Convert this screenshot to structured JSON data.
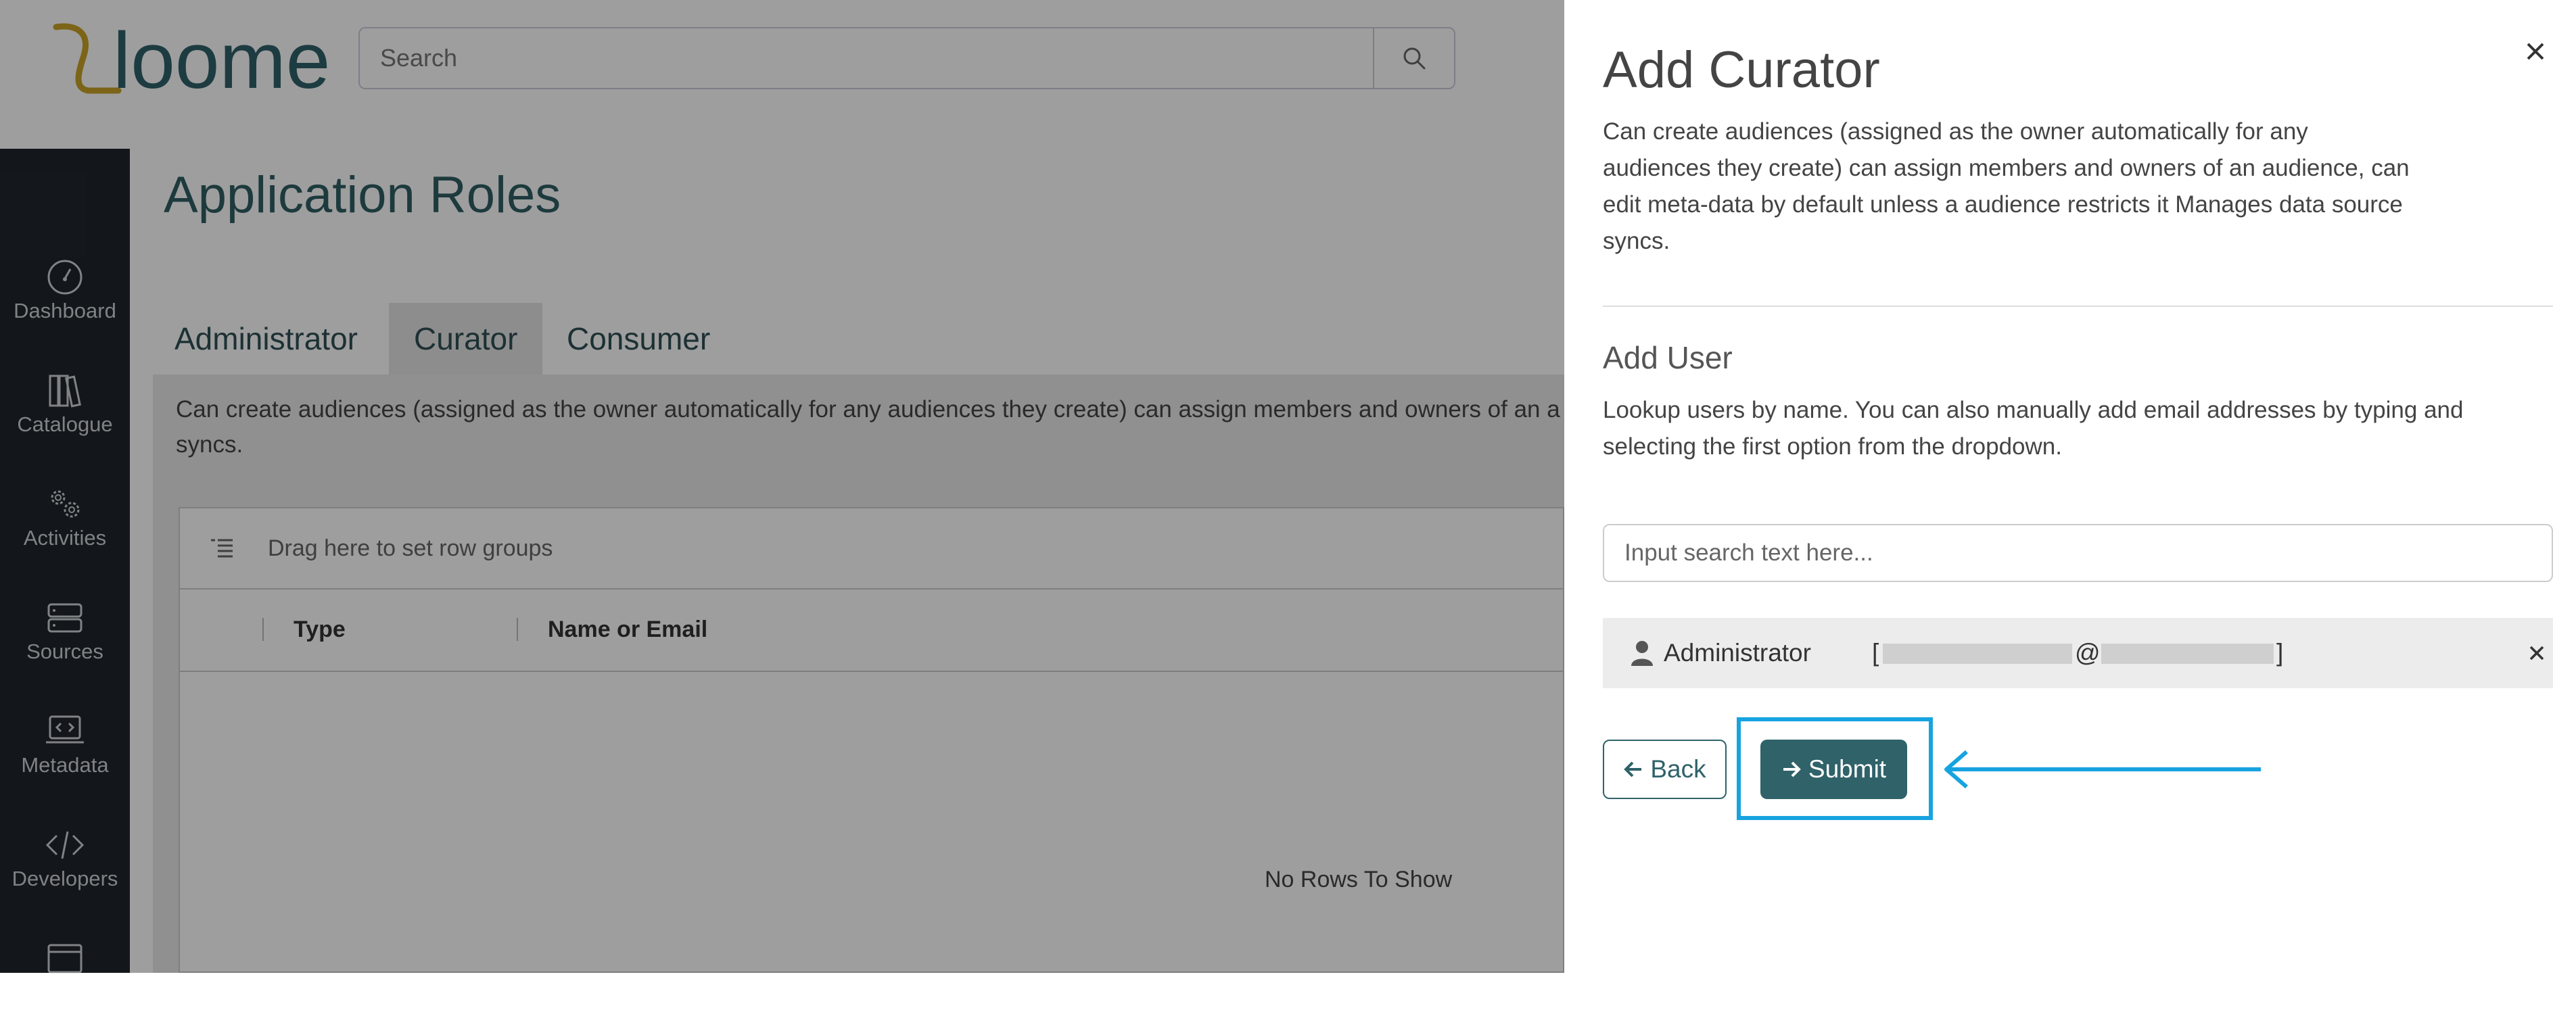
{
  "app": {
    "logo_text": "loome",
    "search": {
      "placeholder": "Search"
    }
  },
  "sidebar": {
    "items": [
      {
        "label": "Dashboard",
        "icon": "dashboard-icon"
      },
      {
        "label": "Catalogue",
        "icon": "catalogue-icon"
      },
      {
        "label": "Activities",
        "icon": "activities-icon"
      },
      {
        "label": "Sources",
        "icon": "sources-icon"
      },
      {
        "label": "Metadata",
        "icon": "metadata-icon"
      },
      {
        "label": "Developers",
        "icon": "developers-icon"
      }
    ]
  },
  "main": {
    "title": "Application Roles",
    "tabs": [
      {
        "label": "Administrator",
        "active": false
      },
      {
        "label": "Curator",
        "active": true
      },
      {
        "label": "Consumer",
        "active": false
      }
    ],
    "description": "Can create audiences (assigned as the owner automatically for any audiences they create) can assign members and owners of an a syncs.",
    "grid": {
      "group_placeholder": "Drag here to set row groups",
      "columns": [
        "Type",
        "Name or Email"
      ],
      "empty_text": "No Rows To Show"
    }
  },
  "panel": {
    "title": "Add Curator",
    "description": "Can create audiences (assigned as the owner automatically for any audiences they create) can assign members and owners of an audience, can edit meta-data by default unless a audience restricts it Manages data source syncs.",
    "add_user": {
      "title": "Add User",
      "description": "Lookup users by name. You can also manually add email addresses by typing and selecting the first option from the dropdown.",
      "input_placeholder": "Input search text here..."
    },
    "selected_user": {
      "role": "Administrator",
      "open_bracket": "[",
      "at": "@",
      "close_bracket": "]"
    },
    "buttons": {
      "back": "Back",
      "submit": "Submit"
    }
  },
  "colors": {
    "brand": "#2f6269",
    "annotation": "#17a3e0",
    "sidebar_bg": "#20252b"
  }
}
